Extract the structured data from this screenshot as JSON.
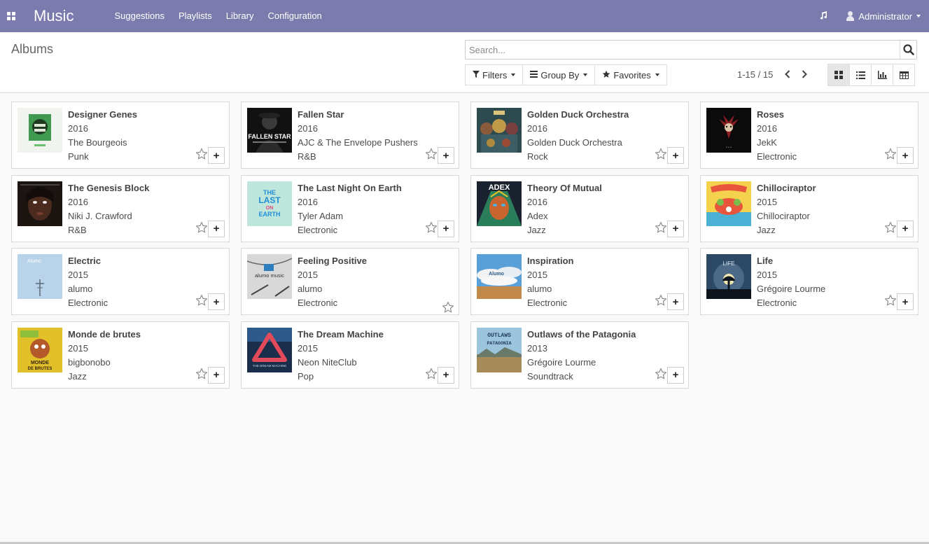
{
  "nav": {
    "brand": "Music",
    "menu": [
      "Suggestions",
      "Playlists",
      "Library",
      "Configuration"
    ],
    "user": "Administrator"
  },
  "control": {
    "breadcrumb": "Albums",
    "search_placeholder": "Search...",
    "filters": "Filters",
    "group_by": "Group By",
    "favorites": "Favorites",
    "pager": "1-15 / 15"
  },
  "albums": [
    {
      "title": "Designer Genes",
      "year": "2016",
      "artist": "The Bourgeois",
      "genre": "Punk",
      "art": "designer"
    },
    {
      "title": "Fallen Star",
      "year": "2016",
      "artist": "AJC & The Envelope Pushers",
      "genre": "R&B",
      "art": "fallen"
    },
    {
      "title": "Golden Duck Orchestra",
      "year": "2016",
      "artist": "Golden Duck Orchestra",
      "genre": "Rock",
      "art": "golden"
    },
    {
      "title": "Roses",
      "year": "2016",
      "artist": "JekK",
      "genre": "Electronic",
      "art": "roses"
    },
    {
      "title": "The Genesis Block",
      "year": "2016",
      "artist": "Niki J. Crawford",
      "genre": "R&B",
      "art": "genesis"
    },
    {
      "title": "The Last Night On Earth",
      "year": "2016",
      "artist": "Tyler Adam",
      "genre": "Electronic",
      "art": "lastnight"
    },
    {
      "title": "Theory Of Mutual",
      "year": "2016",
      "artist": "Adex",
      "genre": "Jazz",
      "art": "adex"
    },
    {
      "title": "Chillociraptor",
      "year": "2015",
      "artist": "Chillociraptor",
      "genre": "Jazz",
      "art": "chillo"
    },
    {
      "title": "Electric",
      "year": "2015",
      "artist": "alumo",
      "genre": "Electronic",
      "art": "electric"
    },
    {
      "title": "Feeling Positive",
      "year": "2015",
      "artist": "alumo",
      "genre": "Electronic",
      "art": "feeling"
    },
    {
      "title": "Inspiration",
      "year": "2015",
      "artist": "alumo",
      "genre": "Electronic",
      "art": "inspiration"
    },
    {
      "title": "Life",
      "year": "2015",
      "artist": "Grégoire Lourme",
      "genre": "Electronic",
      "art": "life"
    },
    {
      "title": "Monde de brutes",
      "year": "2015",
      "artist": "bigbonobo",
      "genre": "Jazz",
      "art": "monde"
    },
    {
      "title": "The Dream Machine",
      "year": "2015",
      "artist": "Neon NiteClub",
      "genre": "Pop",
      "art": "dream"
    },
    {
      "title": "Outlaws of the Patagonia",
      "year": "2013",
      "artist": "Grégoire Lourme",
      "genre": "Soundtrack",
      "art": "outlaws"
    }
  ],
  "album_art_text": {
    "fallen": "FALLEN STAR",
    "lastnight": [
      "THE",
      "LAST",
      "ON",
      "EARTH"
    ],
    "adex": "ADEX",
    "electric": "Alumo",
    "feeling": "alumo music",
    "inspiration": "Alumo",
    "life": "LIFE",
    "monde": [
      "MONDE",
      "DE BRUTES"
    ],
    "dream": "THE DREAM MACHINE",
    "outlaws": [
      "OUTLAWS",
      "PATAGONIA"
    ]
  }
}
